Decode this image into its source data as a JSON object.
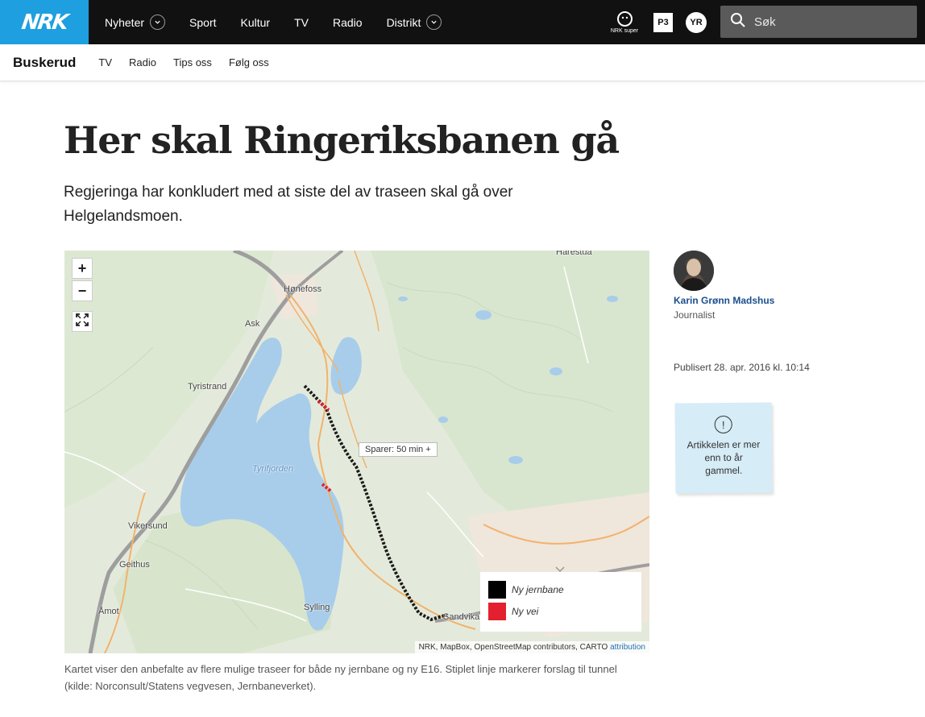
{
  "header": {
    "logo": "NRK",
    "nav": [
      {
        "label": "Nyheter",
        "has_dropdown": true
      },
      {
        "label": "Sport",
        "has_dropdown": false
      },
      {
        "label": "Kultur",
        "has_dropdown": false
      },
      {
        "label": "TV",
        "has_dropdown": false
      },
      {
        "label": "Radio",
        "has_dropdown": false
      },
      {
        "label": "Distrikt",
        "has_dropdown": true
      }
    ],
    "icons": {
      "nrk_super_label": "NRK super",
      "p3_label": "P3",
      "yr_label": "YR"
    },
    "search_placeholder": "Søk"
  },
  "subnav": {
    "section": "Buskerud",
    "items": [
      "TV",
      "Radio",
      "Tips oss",
      "Følg oss"
    ]
  },
  "article": {
    "headline": "Her skal Ringeriksbanen gå",
    "lead": "Regjeringa har konkludert med at siste del av traseen skal gå over Helgelandsmoen.",
    "caption": "Kartet viser den anbefalte av flere mulige traseer for både ny jernbane og ny E16. Stiplet linje markerer forslag til tunnel (kilde: Norconsult/Statens vegvesen, Jernbaneverket)."
  },
  "map": {
    "zoom_in": "+",
    "zoom_out": "−",
    "places": {
      "harestua": "Harestua",
      "honefoss": "Hønefoss",
      "ask": "Ask",
      "tyristrand": "Tyristrand",
      "tyrifjorden": "Tyrifjorden",
      "vikersund": "Vikersund",
      "geithus": "Geithus",
      "amot": "Åmot",
      "sylling": "Sylling",
      "sandvika": "Sandvika"
    },
    "popup": "Sparer: 50 min +",
    "legend": [
      {
        "label": "Ny jernbane",
        "color": "#000000"
      },
      {
        "label": "Ny vei",
        "color": "#e3202f"
      }
    ],
    "attribution": "NRK, MapBox, OpenStreetMap contributors, CARTO",
    "attribution_link": "attribution"
  },
  "byline": {
    "name": "Karin Grønn Madshus",
    "role": "Journalist",
    "published": "Publisert 28. apr. 2016 kl. 10:14"
  },
  "notice": {
    "icon": "!",
    "text": "Artikkelen er mer enn to år gammel."
  },
  "colors": {
    "nrk_blue": "#1e9fe0",
    "topbar": "#111111",
    "rail": "#000000",
    "road": "#e3202f",
    "notice_bg": "#d6ecf7"
  }
}
